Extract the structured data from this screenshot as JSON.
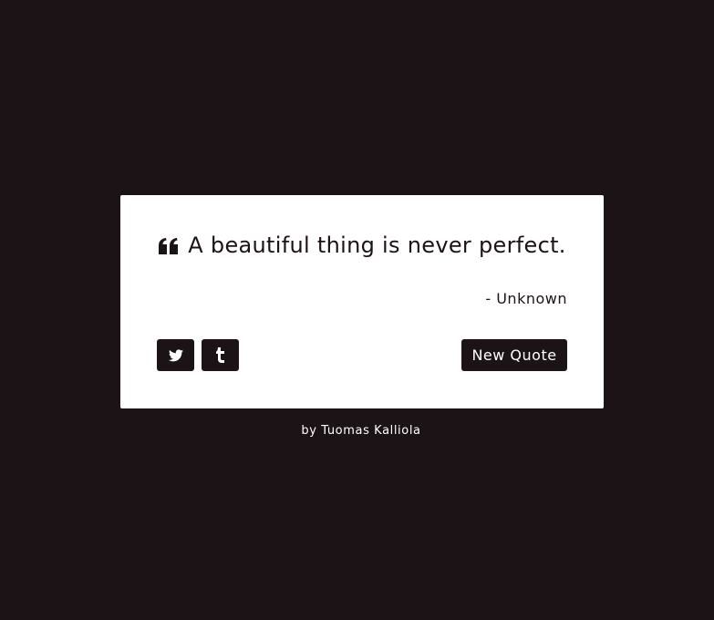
{
  "quote": {
    "text": "A beautiful thing is never perfect.",
    "author": "- Unknown",
    "icon": "quote-left-icon"
  },
  "actions": {
    "tweet_icon": "twitter-icon",
    "tumblr_icon": "tumblr-icon",
    "new_quote_label": "New Quote"
  },
  "footer": {
    "prefix": "by",
    "author": "Tuomas Kalliola"
  },
  "colors": {
    "background": "#1c1316",
    "card": "#ffffff",
    "text": "#1c1316"
  }
}
